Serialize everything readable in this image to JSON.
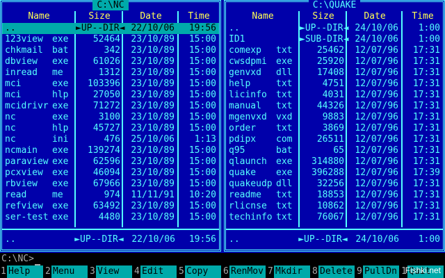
{
  "left_panel": {
    "title": "C:\\NC",
    "headers": {
      "name": "Name",
      "size": "Size",
      "date": "Date",
      "time": "Time"
    },
    "rows": [
      {
        "name": "..",
        "ext": "",
        "size": "►UP--DIR◄",
        "date": "22/10/06",
        "time": "19:56",
        "selected": true
      },
      {
        "name": "123view",
        "ext": "exe",
        "size": "52464",
        "date": "23/10/89",
        "time": "15:00"
      },
      {
        "name": "chkmail",
        "ext": "bat",
        "size": "342",
        "date": "23/10/89",
        "time": "15:00"
      },
      {
        "name": "dbview",
        "ext": "exe",
        "size": "61026",
        "date": "23/10/89",
        "time": "15:00"
      },
      {
        "name": "inread",
        "ext": "me",
        "size": "1312",
        "date": "23/10/89",
        "time": "15:00"
      },
      {
        "name": "mci",
        "ext": "exe",
        "size": "103396",
        "date": "23/10/89",
        "time": "15:00"
      },
      {
        "name": "mci",
        "ext": "hlp",
        "size": "27050",
        "date": "23/10/89",
        "time": "15:00"
      },
      {
        "name": "mcidrivr",
        "ext": "exe",
        "size": "71272",
        "date": "23/10/89",
        "time": "15:00"
      },
      {
        "name": "nc",
        "ext": "exe",
        "size": "3100",
        "date": "23/10/89",
        "time": "15:00"
      },
      {
        "name": "nc",
        "ext": "hlp",
        "size": "45727",
        "date": "23/10/89",
        "time": "15:00"
      },
      {
        "name": "nc",
        "ext": "ini",
        "size": "476",
        "date": "25/10/06",
        "time": "1:13"
      },
      {
        "name": "ncmain",
        "ext": "exe",
        "size": "139274",
        "date": "23/10/89",
        "time": "15:00"
      },
      {
        "name": "paraview",
        "ext": "exe",
        "size": "62596",
        "date": "23/10/89",
        "time": "15:00"
      },
      {
        "name": "pcxview",
        "ext": "exe",
        "size": "46094",
        "date": "23/10/89",
        "time": "15:00"
      },
      {
        "name": "rbview",
        "ext": "exe",
        "size": "67966",
        "date": "23/10/89",
        "time": "15:00"
      },
      {
        "name": "read",
        "ext": "me",
        "size": "974",
        "date": "11/11/91",
        "time": "10:20"
      },
      {
        "name": "refview",
        "ext": "exe",
        "size": "63492",
        "date": "23/10/89",
        "time": "15:00"
      },
      {
        "name": "ser-test",
        "ext": "exe",
        "size": "4480",
        "date": "23/10/89",
        "time": "15:00"
      }
    ],
    "status": {
      "name": "..",
      "size": "►UP--DIR◄",
      "date": "22/10/06",
      "time": "19:56"
    }
  },
  "right_panel": {
    "title": "C:\\QUAKE",
    "headers": {
      "name": "Name",
      "size": "Size",
      "date": "Date",
      "time": "Time"
    },
    "rows": [
      {
        "name": "..",
        "ext": "",
        "size": "►UP--DIR◄",
        "date": "24/10/06",
        "time": "1:00"
      },
      {
        "name": "ID1",
        "ext": "",
        "size": "►SUB-DIR◄",
        "date": "24/10/06",
        "time": "1:00"
      },
      {
        "name": "comexp",
        "ext": "txt",
        "size": "25462",
        "date": "12/07/96",
        "time": "17:31"
      },
      {
        "name": "cwsdpmi",
        "ext": "exe",
        "size": "25920",
        "date": "12/07/96",
        "time": "17:31"
      },
      {
        "name": "genvxd",
        "ext": "dll",
        "size": "17408",
        "date": "12/07/96",
        "time": "17:31"
      },
      {
        "name": "help",
        "ext": "txt",
        "size": "4751",
        "date": "12/07/96",
        "time": "17:31"
      },
      {
        "name": "licinfo",
        "ext": "txt",
        "size": "4031",
        "date": "12/07/96",
        "time": "17:31"
      },
      {
        "name": "manual",
        "ext": "txt",
        "size": "44326",
        "date": "12/07/96",
        "time": "17:31"
      },
      {
        "name": "mgenvxd",
        "ext": "vxd",
        "size": "9883",
        "date": "12/07/96",
        "time": "17:31"
      },
      {
        "name": "order",
        "ext": "txt",
        "size": "3869",
        "date": "12/07/96",
        "time": "17:31"
      },
      {
        "name": "pdipx",
        "ext": "com",
        "size": "26511",
        "date": "12/07/96",
        "time": "17:31"
      },
      {
        "name": "q95",
        "ext": "bat",
        "size": "65",
        "date": "12/07/96",
        "time": "17:31"
      },
      {
        "name": "qlaunch",
        "ext": "exe",
        "size": "314880",
        "date": "12/07/96",
        "time": "17:31"
      },
      {
        "name": "quake",
        "ext": "exe",
        "size": "396288",
        "date": "12/07/96",
        "time": "17:39"
      },
      {
        "name": "quakeudp",
        "ext": "dll",
        "size": "32256",
        "date": "12/07/96",
        "time": "17:31"
      },
      {
        "name": "readme",
        "ext": "txt",
        "size": "18853",
        "date": "12/07/96",
        "time": "17:31"
      },
      {
        "name": "rlicnse",
        "ext": "txt",
        "size": "10862",
        "date": "12/07/96",
        "time": "17:31"
      },
      {
        "name": "techinfo",
        "ext": "txt",
        "size": "76067",
        "date": "12/07/96",
        "time": "17:31"
      }
    ],
    "status": {
      "name": "..",
      "size": "►UP--DIR◄",
      "date": "24/10/06",
      "time": "1:00"
    }
  },
  "command_line": {
    "prompt": "C:\\NC>"
  },
  "function_keys": [
    {
      "num": "1",
      "label": "Help"
    },
    {
      "num": "2",
      "label": "Menu"
    },
    {
      "num": "3",
      "label": "View"
    },
    {
      "num": "4",
      "label": "Edit"
    },
    {
      "num": "5",
      "label": "Copy"
    },
    {
      "num": "6",
      "label": "RenMov"
    },
    {
      "num": "7",
      "label": "Mkdir"
    },
    {
      "num": "8",
      "label": "Delete"
    },
    {
      "num": "9",
      "label": "PullDn"
    },
    {
      "num": "10",
      "label": "Quit"
    }
  ],
  "watermark": "Fishki.net",
  "colors": {
    "panel_bg": "#0000aa",
    "text": "#55ffff",
    "header": "#ffff55",
    "selection": "#00aaaa"
  }
}
